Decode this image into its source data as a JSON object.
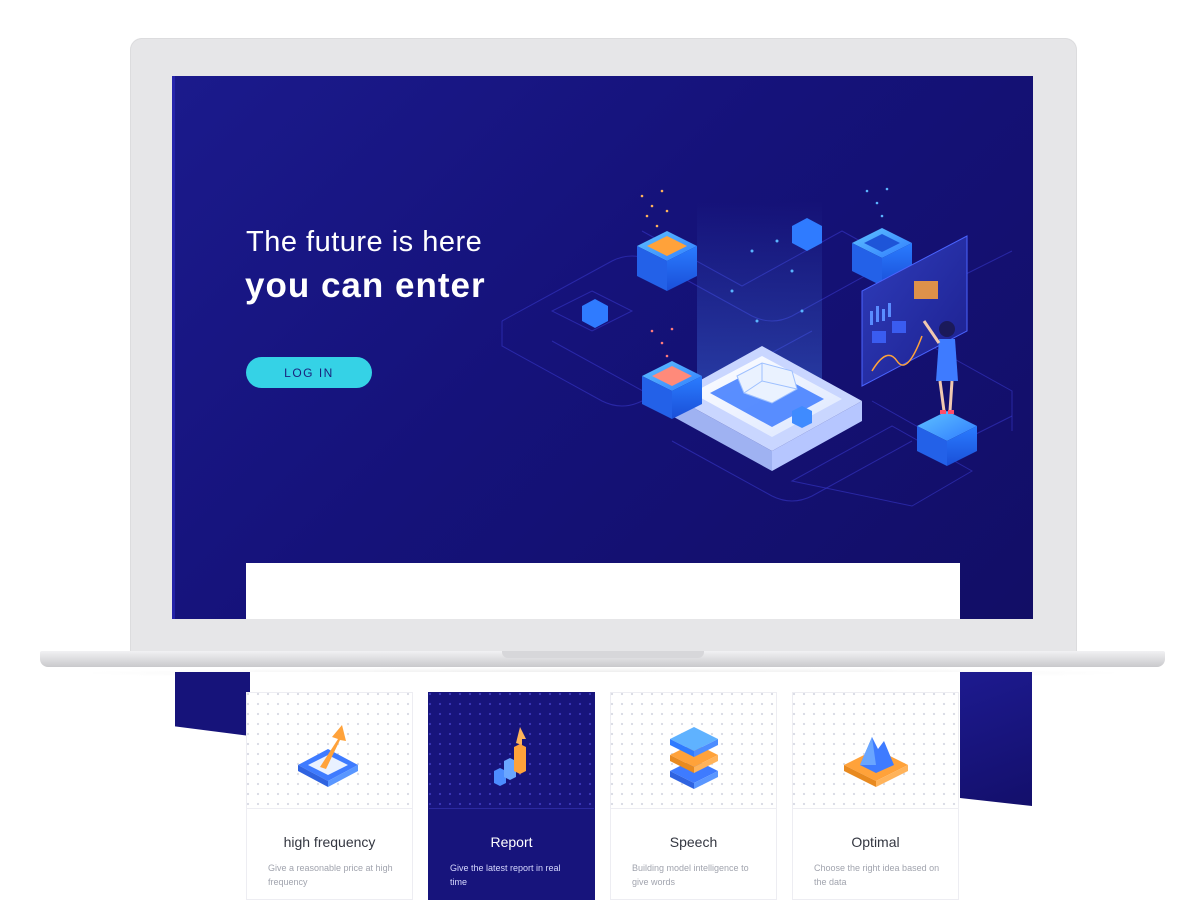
{
  "hero": {
    "title_line1": "The future is here",
    "title_line2": "you can enter",
    "login_label": "LOG IN",
    "illustration_icon": "isometric-data-platform-illustration"
  },
  "features": [
    {
      "title": "high frequency",
      "description": "Give a reasonable price at high frequency",
      "icon": "rising-arrow-frame-icon",
      "active": false
    },
    {
      "title": "Report",
      "description": "Give the latest report in real time",
      "icon": "bar-chart-arrow-icon",
      "active": true
    },
    {
      "title": "Speech",
      "description": "Building model intelligence to give words",
      "icon": "stacked-layers-icon",
      "active": false
    },
    {
      "title": "Optimal",
      "description": "Choose the right idea based on the data",
      "icon": "mountain-peak-icon",
      "active": false
    }
  ],
  "colors": {
    "hero_background": "#15127a",
    "button_accent": "#35d2e6",
    "card_active": "#17147c",
    "icon_blue": "#3e7bff",
    "icon_orange": "#ffa23a"
  }
}
